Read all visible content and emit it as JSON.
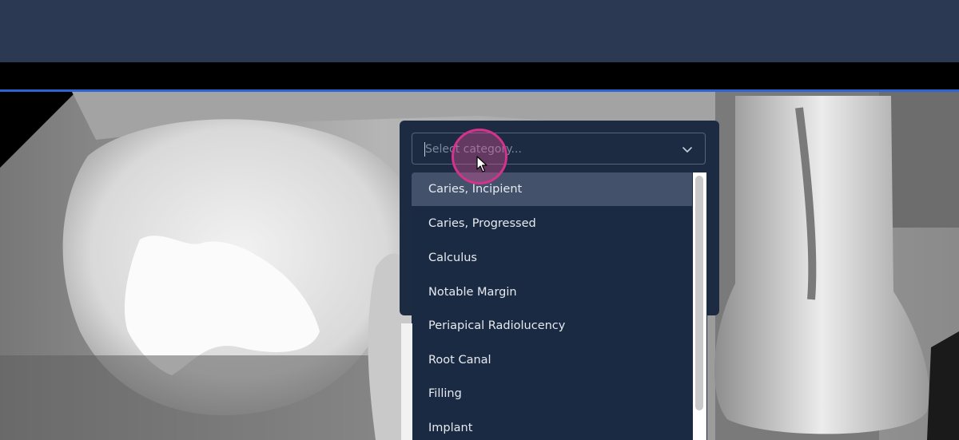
{
  "select": {
    "placeholder": "Select category..."
  },
  "dropdown": {
    "options": [
      "Caries, Incipient",
      "Caries, Progressed",
      "Calculus",
      "Notable Margin",
      "Periapical Radiolucency",
      "Root Canal",
      "Filling",
      "Implant"
    ],
    "highlighted_index": 0
  },
  "colors": {
    "topbar": "#2b3a52",
    "accent": "#2f62d8",
    "panel": "#1c2a42",
    "highlight": "#43526a",
    "cursor_ring": "#d3338b"
  },
  "icons": {
    "select_toggle": "chevron-down-icon",
    "cursor": "pointer-icon"
  }
}
